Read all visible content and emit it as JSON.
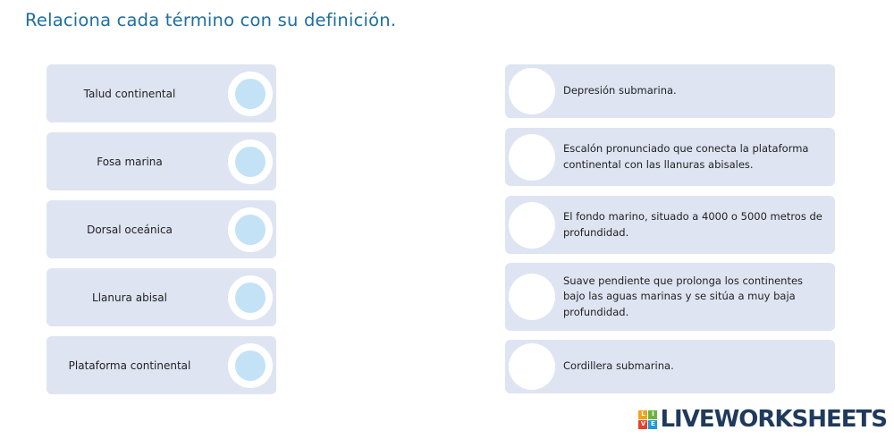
{
  "title": "Relaciona cada término con su definición.",
  "terms": [
    {
      "label": "Talud continental"
    },
    {
      "label": "Fosa marina"
    },
    {
      "label": "Dorsal oceánica"
    },
    {
      "label": "Llanura abisal"
    },
    {
      "label": "Plataforma continental"
    }
  ],
  "definitions": [
    {
      "text": "Depresión submarina."
    },
    {
      "text": "Escalón pronunciado que conecta la plataforma continental con las llanuras abisales."
    },
    {
      "text": "El fondo marino, situado a 4000 o 5000 metros de profundidad."
    },
    {
      "text": "Suave pendiente que prolonga los continentes bajo las aguas marinas y se sitúa a muy baja profundidad."
    },
    {
      "text": "Cordillera submarina."
    }
  ],
  "branding": {
    "text": "LIVEWORKSHEETS",
    "logo_letters": [
      "L",
      "I",
      "V",
      "E"
    ],
    "logo_colors": [
      "#f0a31c",
      "#6cb33f",
      "#e8412b",
      "#1f9ad6"
    ],
    "text_color": "#1f3a5c"
  },
  "colors": {
    "title": "#1d6fa0",
    "card_bg": "#dfe4f2",
    "term_connector": "#c3e2f6",
    "def_connector": "#ffffff"
  }
}
